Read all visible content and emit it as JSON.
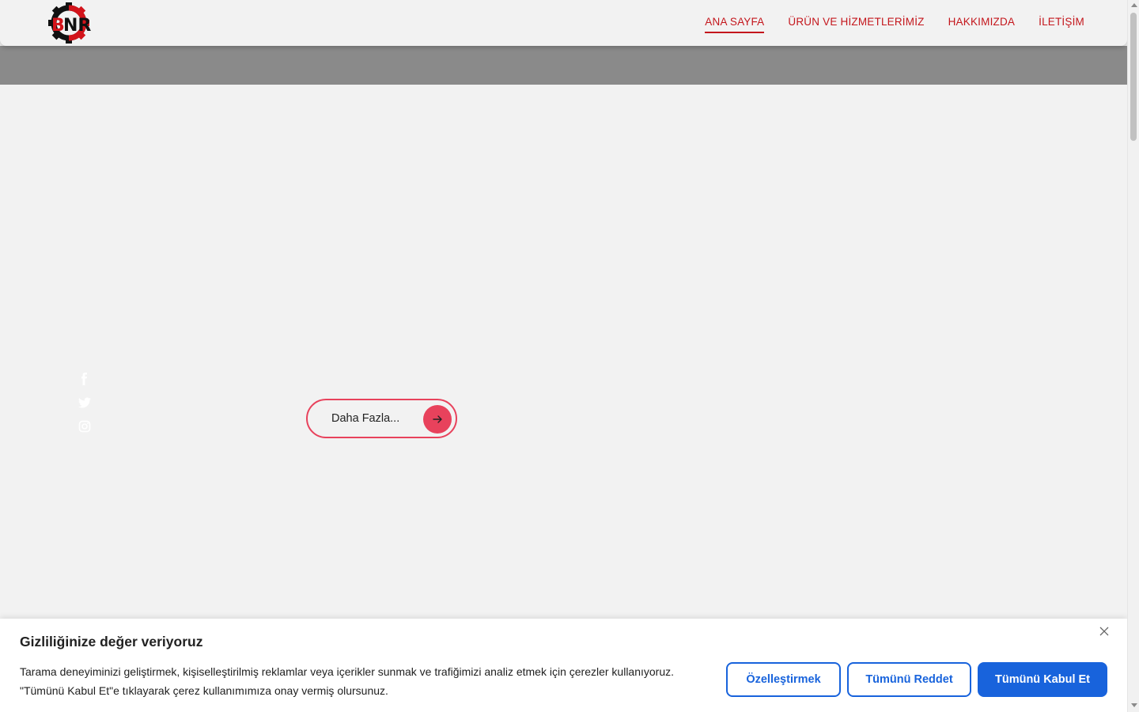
{
  "header": {
    "logo_text": "BNR",
    "nav": [
      {
        "label": "ANA SAYFA",
        "active": true
      },
      {
        "label": "ÜRÜN VE HİZMETLERİMİZ",
        "active": false
      },
      {
        "label": "HAKKIMIZDA",
        "active": false
      },
      {
        "label": "İLETİŞİM",
        "active": false
      }
    ]
  },
  "social": {
    "icons": [
      "facebook-icon",
      "twitter-icon",
      "instagram-icon"
    ]
  },
  "hero": {
    "more_label": "Daha Fazla...",
    "more_icon": "arrow-right-icon"
  },
  "cookie": {
    "title": "Gizliliğinize değer veriyoruz",
    "text_line1": "Tarama deneyiminizi geliştirmek, kişiselleştirilmiş reklamlar veya içerikler sunmak ve trafiğimizi analiz etmek için çerezler kullanıyoruz.",
    "text_line2": "\"Tümünü Kabul Et\"e tıklayarak çerez kullanımımıza onay vermiş olursunuz.",
    "customize_label": "Özelleştirmek",
    "reject_label": "Tümünü Reddet",
    "accept_label": "Tümünü Kabul Et",
    "close_icon": "close-icon"
  },
  "colors": {
    "brand_red": "#c4161c",
    "accent_pink": "#e8425c",
    "cookie_blue": "#1863dc",
    "band_grey": "#8a8a8a"
  }
}
